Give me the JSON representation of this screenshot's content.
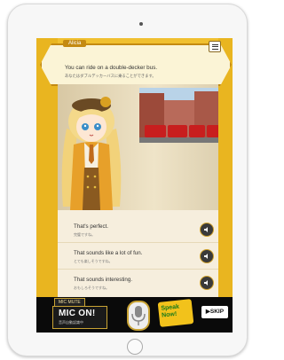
{
  "dialog": {
    "speaker": "Alicia",
    "text_en": "You can ride on a double-decker bus.",
    "text_jp": "あなたはダブルデッカーバスに乗ることができます。"
  },
  "choices": [
    {
      "en": "That's perfect.",
      "jp": "完璧ですね。"
    },
    {
      "en": "That sounds like a lot of fun.",
      "jp": "とても楽しそうですね。"
    },
    {
      "en": "That sounds interesting.",
      "jp": "おもしろそうですね。"
    }
  ],
  "controls": {
    "mic_mute": "MIC MUTE",
    "mic_on": "MIC ON!",
    "mic_on_sub": "音声自動認識中",
    "speak_now": "Speak Now!",
    "skip": "▶SKIP"
  },
  "colors": {
    "background": "#f0c030",
    "accent": "#c48a12",
    "bus": "#c81e1e"
  }
}
